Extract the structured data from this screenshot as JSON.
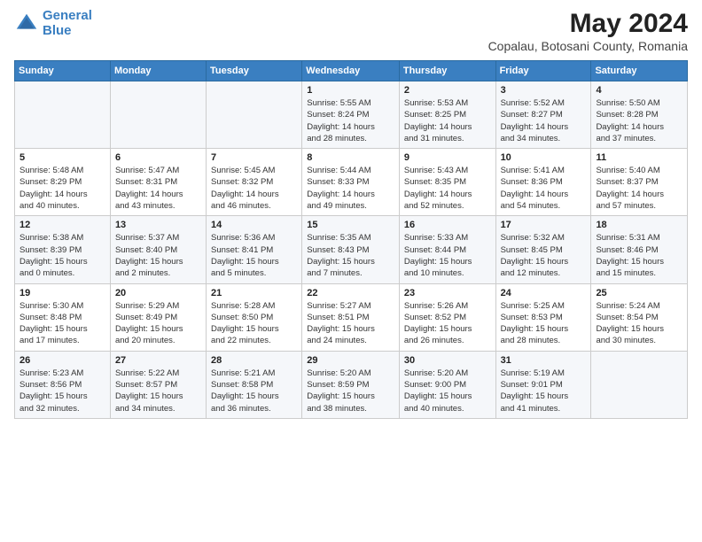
{
  "logo": {
    "line1": "General",
    "line2": "Blue"
  },
  "title": "May 2024",
  "subtitle": "Copalau, Botosani County, Romania",
  "days_of_week": [
    "Sunday",
    "Monday",
    "Tuesday",
    "Wednesday",
    "Thursday",
    "Friday",
    "Saturday"
  ],
  "weeks": [
    [
      {
        "day": "",
        "info": ""
      },
      {
        "day": "",
        "info": ""
      },
      {
        "day": "",
        "info": ""
      },
      {
        "day": "1",
        "info": "Sunrise: 5:55 AM\nSunset: 8:24 PM\nDaylight: 14 hours\nand 28 minutes."
      },
      {
        "day": "2",
        "info": "Sunrise: 5:53 AM\nSunset: 8:25 PM\nDaylight: 14 hours\nand 31 minutes."
      },
      {
        "day": "3",
        "info": "Sunrise: 5:52 AM\nSunset: 8:27 PM\nDaylight: 14 hours\nand 34 minutes."
      },
      {
        "day": "4",
        "info": "Sunrise: 5:50 AM\nSunset: 8:28 PM\nDaylight: 14 hours\nand 37 minutes."
      }
    ],
    [
      {
        "day": "5",
        "info": "Sunrise: 5:48 AM\nSunset: 8:29 PM\nDaylight: 14 hours\nand 40 minutes."
      },
      {
        "day": "6",
        "info": "Sunrise: 5:47 AM\nSunset: 8:31 PM\nDaylight: 14 hours\nand 43 minutes."
      },
      {
        "day": "7",
        "info": "Sunrise: 5:45 AM\nSunset: 8:32 PM\nDaylight: 14 hours\nand 46 minutes."
      },
      {
        "day": "8",
        "info": "Sunrise: 5:44 AM\nSunset: 8:33 PM\nDaylight: 14 hours\nand 49 minutes."
      },
      {
        "day": "9",
        "info": "Sunrise: 5:43 AM\nSunset: 8:35 PM\nDaylight: 14 hours\nand 52 minutes."
      },
      {
        "day": "10",
        "info": "Sunrise: 5:41 AM\nSunset: 8:36 PM\nDaylight: 14 hours\nand 54 minutes."
      },
      {
        "day": "11",
        "info": "Sunrise: 5:40 AM\nSunset: 8:37 PM\nDaylight: 14 hours\nand 57 minutes."
      }
    ],
    [
      {
        "day": "12",
        "info": "Sunrise: 5:38 AM\nSunset: 8:39 PM\nDaylight: 15 hours\nand 0 minutes."
      },
      {
        "day": "13",
        "info": "Sunrise: 5:37 AM\nSunset: 8:40 PM\nDaylight: 15 hours\nand 2 minutes."
      },
      {
        "day": "14",
        "info": "Sunrise: 5:36 AM\nSunset: 8:41 PM\nDaylight: 15 hours\nand 5 minutes."
      },
      {
        "day": "15",
        "info": "Sunrise: 5:35 AM\nSunset: 8:43 PM\nDaylight: 15 hours\nand 7 minutes."
      },
      {
        "day": "16",
        "info": "Sunrise: 5:33 AM\nSunset: 8:44 PM\nDaylight: 15 hours\nand 10 minutes."
      },
      {
        "day": "17",
        "info": "Sunrise: 5:32 AM\nSunset: 8:45 PM\nDaylight: 15 hours\nand 12 minutes."
      },
      {
        "day": "18",
        "info": "Sunrise: 5:31 AM\nSunset: 8:46 PM\nDaylight: 15 hours\nand 15 minutes."
      }
    ],
    [
      {
        "day": "19",
        "info": "Sunrise: 5:30 AM\nSunset: 8:48 PM\nDaylight: 15 hours\nand 17 minutes."
      },
      {
        "day": "20",
        "info": "Sunrise: 5:29 AM\nSunset: 8:49 PM\nDaylight: 15 hours\nand 20 minutes."
      },
      {
        "day": "21",
        "info": "Sunrise: 5:28 AM\nSunset: 8:50 PM\nDaylight: 15 hours\nand 22 minutes."
      },
      {
        "day": "22",
        "info": "Sunrise: 5:27 AM\nSunset: 8:51 PM\nDaylight: 15 hours\nand 24 minutes."
      },
      {
        "day": "23",
        "info": "Sunrise: 5:26 AM\nSunset: 8:52 PM\nDaylight: 15 hours\nand 26 minutes."
      },
      {
        "day": "24",
        "info": "Sunrise: 5:25 AM\nSunset: 8:53 PM\nDaylight: 15 hours\nand 28 minutes."
      },
      {
        "day": "25",
        "info": "Sunrise: 5:24 AM\nSunset: 8:54 PM\nDaylight: 15 hours\nand 30 minutes."
      }
    ],
    [
      {
        "day": "26",
        "info": "Sunrise: 5:23 AM\nSunset: 8:56 PM\nDaylight: 15 hours\nand 32 minutes."
      },
      {
        "day": "27",
        "info": "Sunrise: 5:22 AM\nSunset: 8:57 PM\nDaylight: 15 hours\nand 34 minutes."
      },
      {
        "day": "28",
        "info": "Sunrise: 5:21 AM\nSunset: 8:58 PM\nDaylight: 15 hours\nand 36 minutes."
      },
      {
        "day": "29",
        "info": "Sunrise: 5:20 AM\nSunset: 8:59 PM\nDaylight: 15 hours\nand 38 minutes."
      },
      {
        "day": "30",
        "info": "Sunrise: 5:20 AM\nSunset: 9:00 PM\nDaylight: 15 hours\nand 40 minutes."
      },
      {
        "day": "31",
        "info": "Sunrise: 5:19 AM\nSunset: 9:01 PM\nDaylight: 15 hours\nand 41 minutes."
      },
      {
        "day": "",
        "info": ""
      }
    ]
  ]
}
